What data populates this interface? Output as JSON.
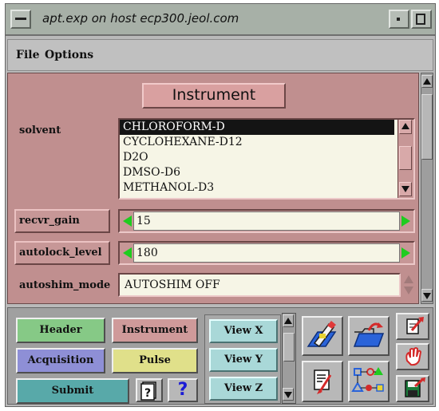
{
  "window": {
    "title": "apt.exp on host ecp300.jeol.com"
  },
  "menubar": {
    "file": "File",
    "options": "Options"
  },
  "form": {
    "section_title": "Instrument",
    "solvent": {
      "label": "solvent",
      "items": [
        "CHLOROFORM-D",
        "CYCLOHEXANE-D12",
        "D2O",
        "DMSO-D6",
        "METHANOL-D3"
      ],
      "selected": "CHLOROFORM-D"
    },
    "recvr_gain": {
      "label": "recvr_gain",
      "value": "15"
    },
    "autolock_level": {
      "label": "autolock_level",
      "value": "180"
    },
    "autoshim_mode": {
      "label": "autoshim_mode",
      "value": "AUTOSHIM OFF"
    }
  },
  "bottom": {
    "header": "Header",
    "instrument": "Instrument",
    "acquisition": "Acquisition",
    "pulse": "Pulse",
    "submit": "Submit",
    "help_glyph": "?",
    "view_x": "View X",
    "view_y": "View Y",
    "view_z": "View Z"
  },
  "colors": {
    "form_bg": "#c08f8f",
    "header_btn": "#86c986",
    "instrument_btn": "#cf9a9a",
    "acquisition_btn": "#8e8fd6",
    "pulse_btn": "#e0e08a",
    "submit_btn": "#58a9a9",
    "view_btn": "#a9d8d8",
    "arrow_green": "#1fcc1f"
  },
  "icons": [
    "window-menu-icon",
    "minimize-icon",
    "maximize-icon",
    "help-book-icon",
    "question-icon",
    "edit-params-icon",
    "open-folder-icon",
    "edit-note-icon",
    "flowchart-icon",
    "export-icon",
    "stop-hand-icon",
    "save-disk-icon"
  ]
}
